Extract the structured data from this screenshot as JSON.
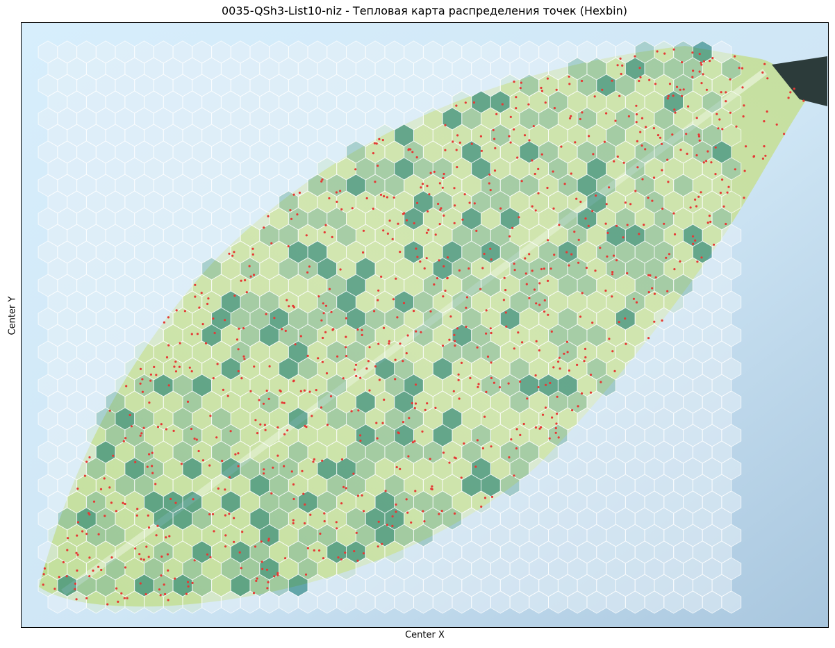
{
  "chart_data": {
    "type": "heatmap",
    "subtype": "hexbin",
    "title": "0035-QSh3-List10-niz - Тепловая карта распределения точек (Hexbin)",
    "xlabel": "Center X",
    "ylabel": "Center Y",
    "ticks": "hidden",
    "grid": false,
    "background": "photograph of a leaf (microscopy scan)",
    "hexbin": {
      "cmap": "viridis-like (teal)",
      "alpha": 0.45,
      "edgecolor": "#ffffff"
    },
    "points": {
      "color": "#e53935",
      "marker": "dot",
      "approx_count": 900
    },
    "colors": {
      "background_blue": "#cfe6f5",
      "leaf_green": "#c7df9a",
      "hex_low": "#e6f0f8",
      "hex_mid": "#7fb8a6",
      "hex_high": "#1f7f7a",
      "point": "#e53935"
    }
  }
}
